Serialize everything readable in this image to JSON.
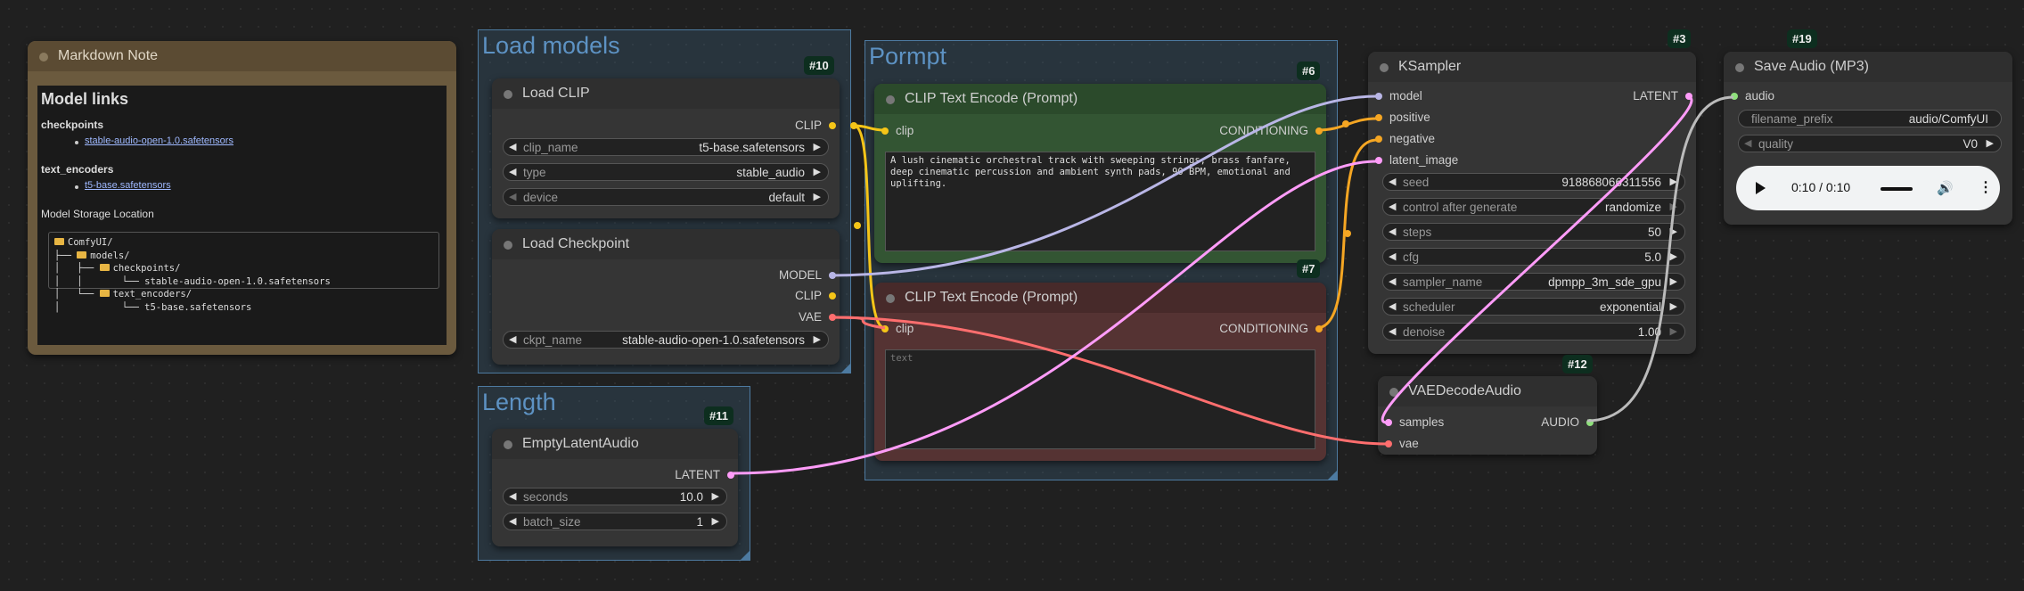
{
  "markdown_note": {
    "title": "Markdown Note",
    "heading": "Model links",
    "checkpoints_heading": "checkpoints",
    "checkpoint_link": "stable-audio-open-1.0.safetensors",
    "text_encoders_heading": "text_encoders",
    "text_encoder_link": "t5-base.safetensors",
    "storage_label": "Model Storage Location",
    "tree": [
      "ComfyUI/",
      "models/",
      "checkpoints/",
      "stable-audio-open-1.0.safetensors",
      "text_encoders/",
      "t5-base.safetensors"
    ]
  },
  "groups": {
    "load_models": "Load models",
    "prompt": "Pormpt",
    "length": "Length"
  },
  "load_clip": {
    "title": "Load CLIP",
    "badge": "#10",
    "output": "CLIP",
    "widgets": [
      {
        "label": "clip_name",
        "value": "t5-base.safetensors"
      },
      {
        "label": "type",
        "value": "stable_audio"
      },
      {
        "label": "device",
        "value": "default"
      }
    ]
  },
  "load_checkpoint": {
    "title": "Load Checkpoint",
    "outputs": [
      "MODEL",
      "CLIP",
      "VAE"
    ],
    "widget": {
      "label": "ckpt_name",
      "value": "stable-audio-open-1.0.safetensors"
    }
  },
  "empty_latent": {
    "title": "EmptyLatentAudio",
    "badge": "#11",
    "output": "LATENT",
    "widgets": [
      {
        "label": "seconds",
        "value": "10.0"
      },
      {
        "label": "batch_size",
        "value": "1"
      }
    ]
  },
  "clip_pos": {
    "title": "CLIP Text Encode (Prompt)",
    "badge": "#6",
    "input": "clip",
    "output": "CONDITIONING",
    "text": "A lush cinematic orchestral track with sweeping strings, brass fanfare, deep cinematic percussion and ambient synth pads, 90 BPM, emotional and uplifting."
  },
  "clip_neg": {
    "title": "CLIP Text Encode (Prompt)",
    "badge": "#7",
    "input": "clip",
    "output": "CONDITIONING",
    "placeholder": "text"
  },
  "ksampler": {
    "title": "KSampler",
    "badge": "#3",
    "inputs": [
      "model",
      "positive",
      "negative",
      "latent_image"
    ],
    "output": "LATENT",
    "widgets": [
      {
        "label": "seed",
        "value": "918868066311556"
      },
      {
        "label": "control after generate",
        "value": "randomize"
      },
      {
        "label": "steps",
        "value": "50"
      },
      {
        "label": "cfg",
        "value": "5.0"
      },
      {
        "label": "sampler_name",
        "value": "dpmpp_3m_sde_gpu"
      },
      {
        "label": "scheduler",
        "value": "exponential"
      },
      {
        "label": "denoise",
        "value": "1.00"
      }
    ]
  },
  "vae_decode": {
    "title": "VAEDecodeAudio",
    "badge": "#12",
    "inputs": [
      "samples",
      "vae"
    ],
    "output": "AUDIO"
  },
  "save_audio": {
    "title": "Save Audio (MP3)",
    "badge": "#19",
    "input": "audio",
    "widgets": [
      {
        "label": "filename_prefix",
        "value": "audio/ComfyUI"
      },
      {
        "label": "quality",
        "value": "V0"
      }
    ],
    "player_time": "0:10 / 0:10"
  },
  "colors": {
    "canvas": "#202020",
    "group": "#3a5f7d",
    "clip_link": "#f5c518",
    "cond_link": "#f5a623",
    "model_link": "#b9b6e6",
    "vae_link": "#ff6e6e",
    "latent_link": "#ff9cf9",
    "audio_link": "#8ee07b",
    "pos_node": "#335533",
    "neg_node": "#553333",
    "note_node": "#6b5a3e"
  }
}
